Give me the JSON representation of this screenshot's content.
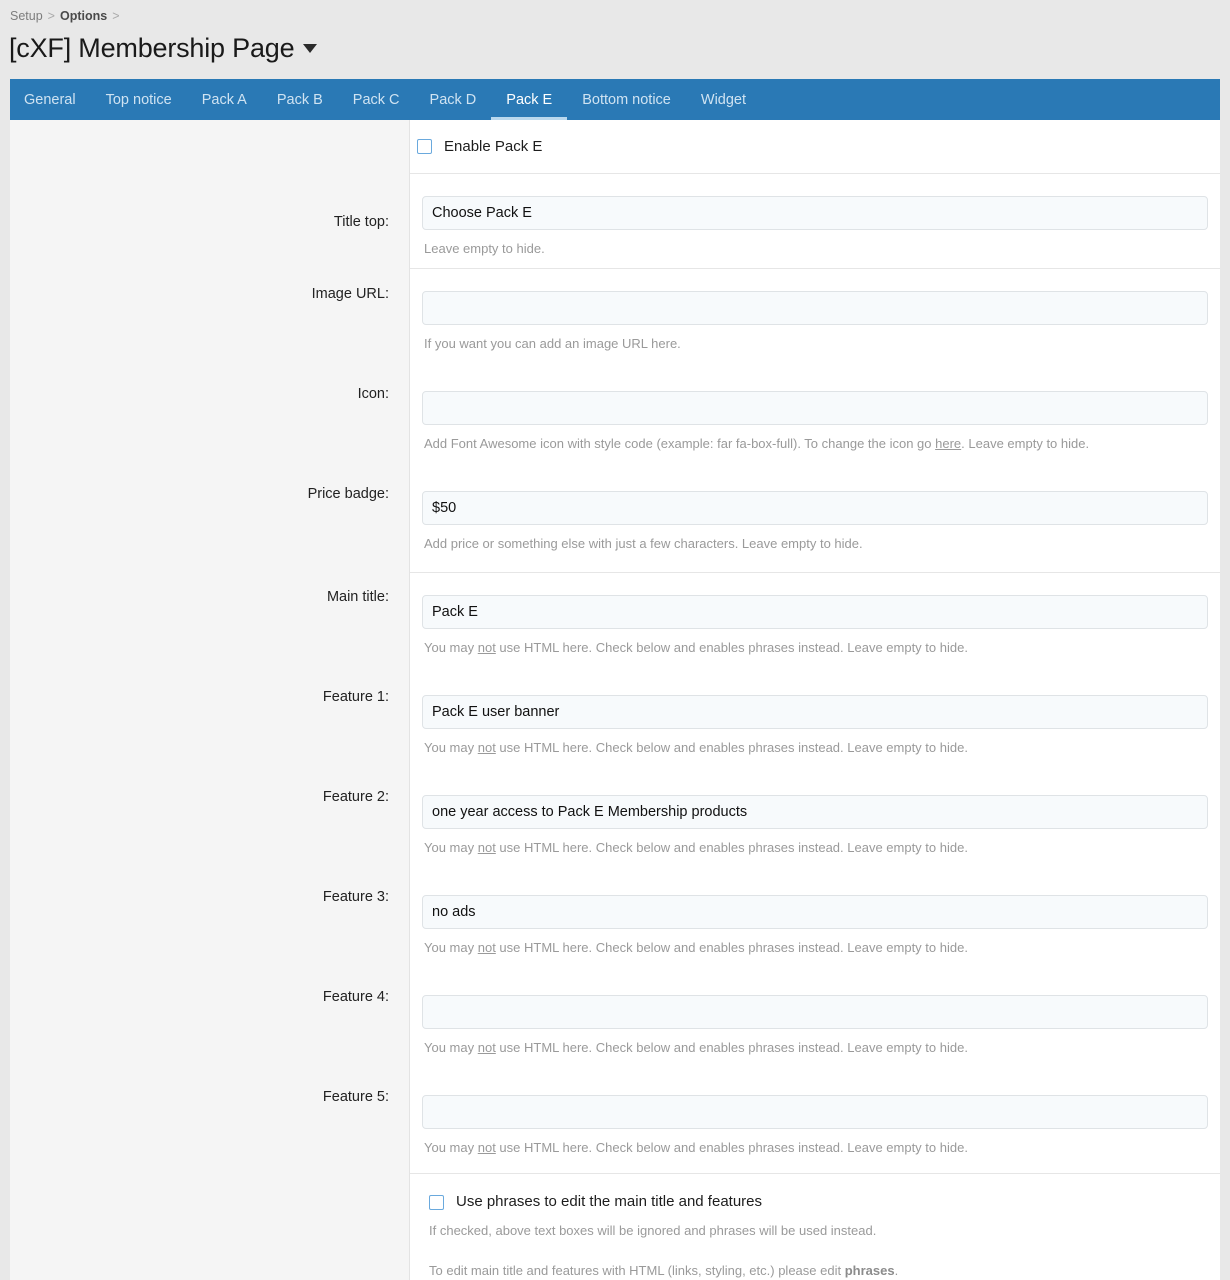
{
  "breadcrumb": {
    "items": [
      {
        "label": "Setup",
        "strong": false
      },
      {
        "label": "Options",
        "strong": true
      }
    ],
    "separator": ">"
  },
  "header": {
    "title": "[cXF] Membership Page",
    "caret_icon": "chevron-down-icon"
  },
  "tabs": [
    {
      "label": "General",
      "active": false
    },
    {
      "label": "Top notice",
      "active": false
    },
    {
      "label": "Pack A",
      "active": false
    },
    {
      "label": "Pack B",
      "active": false
    },
    {
      "label": "Pack C",
      "active": false
    },
    {
      "label": "Pack D",
      "active": false
    },
    {
      "label": "Pack E",
      "active": true
    },
    {
      "label": "Bottom notice",
      "active": false
    },
    {
      "label": "Widget",
      "active": false
    }
  ],
  "form": {
    "enable": {
      "label": "Enable Pack E",
      "checked": false
    },
    "fields": [
      {
        "label": "Title top:",
        "value": "Choose Pack E",
        "placeholder": "",
        "hint": "Leave empty to hide."
      },
      {
        "label": "Image URL:",
        "value": "",
        "placeholder": "",
        "hint": "If you want you can add an image URL here."
      },
      {
        "label": "Icon:",
        "value": "",
        "placeholder": "",
        "hint_pre": "Add Font Awesome icon with style code (example: far fa-box-full). To change the icon go ",
        "hint_link": "here",
        "hint_post": ". Leave empty to hide."
      },
      {
        "label": "Price badge:",
        "value": "$50",
        "placeholder": "",
        "hint": "Add price or something else with just a few characters. Leave empty to hide."
      },
      {
        "label": "Main title:",
        "value": "Pack E",
        "placeholder": "",
        "hint_pre": "You may ",
        "hint_em": "not",
        "hint_post": " use HTML here. Check below and enables phrases instead. Leave empty to hide."
      },
      {
        "label": "Feature 1:",
        "value": "Pack E user banner",
        "placeholder": "",
        "hint_pre": "You may ",
        "hint_em": "not",
        "hint_post": " use HTML here. Check below and enables phrases instead. Leave empty to hide."
      },
      {
        "label": "Feature 2:",
        "value": "one year access to Pack E Membership products",
        "placeholder": "",
        "hint_pre": "You may ",
        "hint_em": "not",
        "hint_post": " use HTML here. Check below and enables phrases instead. Leave empty to hide."
      },
      {
        "label": "Feature 3:",
        "value": "no ads",
        "placeholder": "",
        "hint_pre": "You may ",
        "hint_em": "not",
        "hint_post": " use HTML here. Check below and enables phrases instead. Leave empty to hide."
      },
      {
        "label": "Feature 4:",
        "value": "",
        "placeholder": "",
        "hint_pre": "You may ",
        "hint_em": "not",
        "hint_post": " use HTML here. Check below and enables phrases instead. Leave empty to hide."
      },
      {
        "label": "Feature 5:",
        "value": "",
        "placeholder": "",
        "hint_pre": "You may ",
        "hint_em": "not",
        "hint_post": " use HTML here. Check below and enables phrases instead. Leave empty to hide."
      }
    ],
    "phrases": {
      "label": "Use phrases to edit the main title and features",
      "checked": false,
      "hint1": "If checked, above text boxes will be ignored and phrases will be used instead.",
      "hint2_pre": "To edit main title and features with HTML (links, styling, etc.) please edit ",
      "hint2_em": "phrases",
      "hint2_post": "."
    }
  },
  "colors": {
    "tab_bar": "#2a79b5",
    "tab_active_underline": "#b9d8ee",
    "tab_inactive_text": "#cfe3f2",
    "checkbox_border": "#6aa9dd",
    "field_bg": "#f7fafc",
    "label_col_bg": "#f5f5f5",
    "page_bg": "#e8e8e8"
  }
}
